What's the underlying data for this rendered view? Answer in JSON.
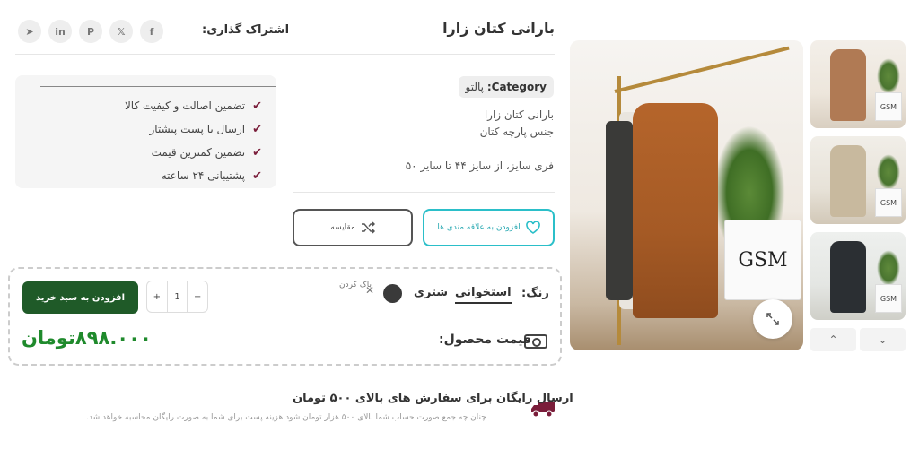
{
  "product": {
    "title": "بارانی کتان زارا",
    "category_label": "Category:",
    "category_value": "پالتو",
    "desc_line1": "بارانی کتان زارا",
    "desc_line2": "جنس پارچه کتان",
    "desc_line3": "فری سایز، از سایز ۴۴ تا سایز ۵۰"
  },
  "share": {
    "label": "اشتراک گذاری:",
    "icons": [
      "telegram-icon",
      "linkedin-icon",
      "pinterest-icon",
      "x-icon",
      "facebook-icon"
    ],
    "glyphs": [
      "➤",
      "in",
      "P",
      "𝕏",
      "f"
    ]
  },
  "guarantees": [
    "تضمین اصالت و کیفیت کالا",
    "ارسال با پست پیشتاز",
    "تضمین کمترین قیمت",
    "پشتیبانی ۲۴ ساعته"
  ],
  "actions": {
    "wishlist_label": "افزودن به علاقه مندی ها",
    "compare_label": "مقایسه"
  },
  "purchase": {
    "color_label": "رنگ:",
    "color_options": [
      "استخوانی",
      "شتری"
    ],
    "selected_color": "استخوانی",
    "clear_label": "پاک کردن",
    "quantity": "1",
    "minus": "−",
    "plus": "+",
    "add_to_cart_label": "افزودن به سبد خرید",
    "price_label": "قیمت محصول:",
    "price_value": "۸۹۸.۰۰۰تومان"
  },
  "shipping": {
    "title": "ارسال رایگان برای سفارش های بالای ۵۰۰ تومان",
    "note": "چنان چه جمع صورت حساب شما بالای ۵۰۰ هزار تومان شود هزینه پست برای شما به صورت رایگان محاسبه خواهد شد."
  },
  "gallery": {
    "bag_text": "GSM",
    "thumb_nav_up": "⌃",
    "thumb_nav_down": "⌄"
  },
  "colors": {
    "primary_green": "#1f5a28",
    "price_green": "#1f8a2c",
    "accent_teal": "#2bbfc9",
    "check_maroon": "#7a1d3a"
  }
}
